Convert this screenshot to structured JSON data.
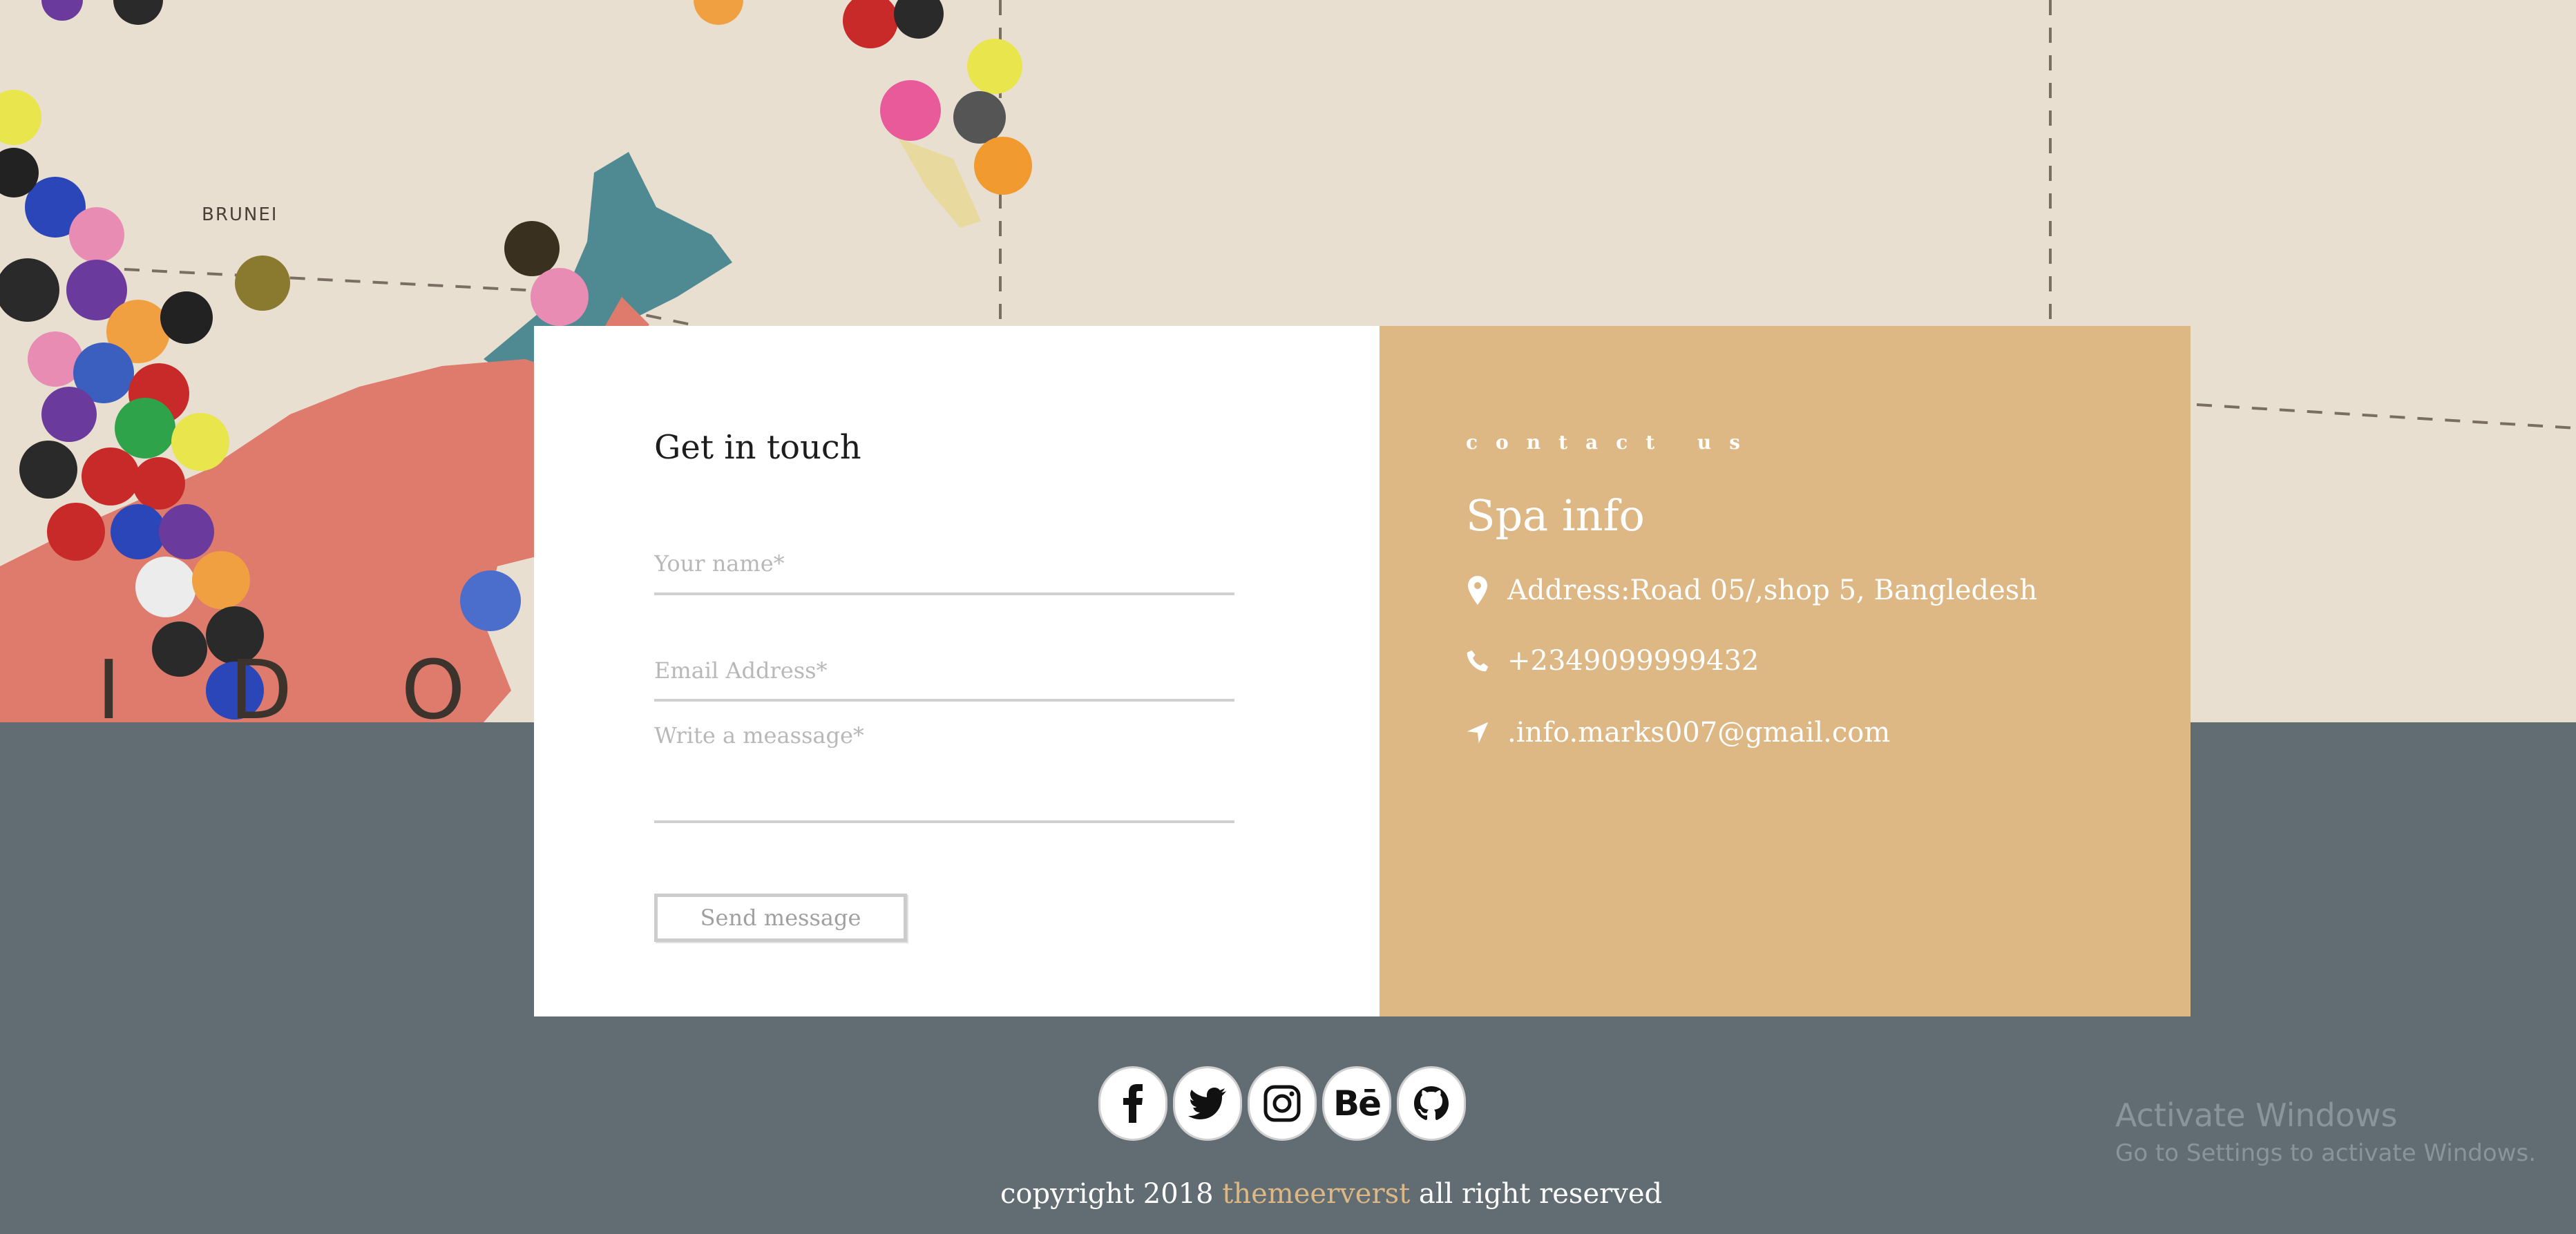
{
  "hero": {
    "map_labels": {
      "brunei": "BRUNEI",
      "country": "I D O"
    }
  },
  "contact_form": {
    "title": "Get in touch",
    "name_placeholder": "Your name*",
    "email_placeholder": "Email Address*",
    "message_placeholder": "Write a meassage*",
    "send_label": "Send message"
  },
  "info": {
    "eyebrow": "contact us",
    "title": "Spa info",
    "address": "Address:Road 05/,shop 5, Bangledesh",
    "phone": "+2349099999432",
    "email": ".info.marks007@gmail.com"
  },
  "social": [
    "facebook-icon",
    "twitter-icon",
    "instagram-icon",
    "behance-icon",
    "github-icon"
  ],
  "footer": {
    "copyright_prefix": "copyright 2018 ",
    "brand": "themeerverst",
    "copyright_suffix": " all right reserved"
  },
  "watermark": {
    "title": "Activate Windows",
    "subtitle": "Go to Settings to activate Windows."
  },
  "colors": {
    "accent": "#ddb784",
    "footer_bg": "#626d73",
    "card_bg": "#ffffff"
  }
}
